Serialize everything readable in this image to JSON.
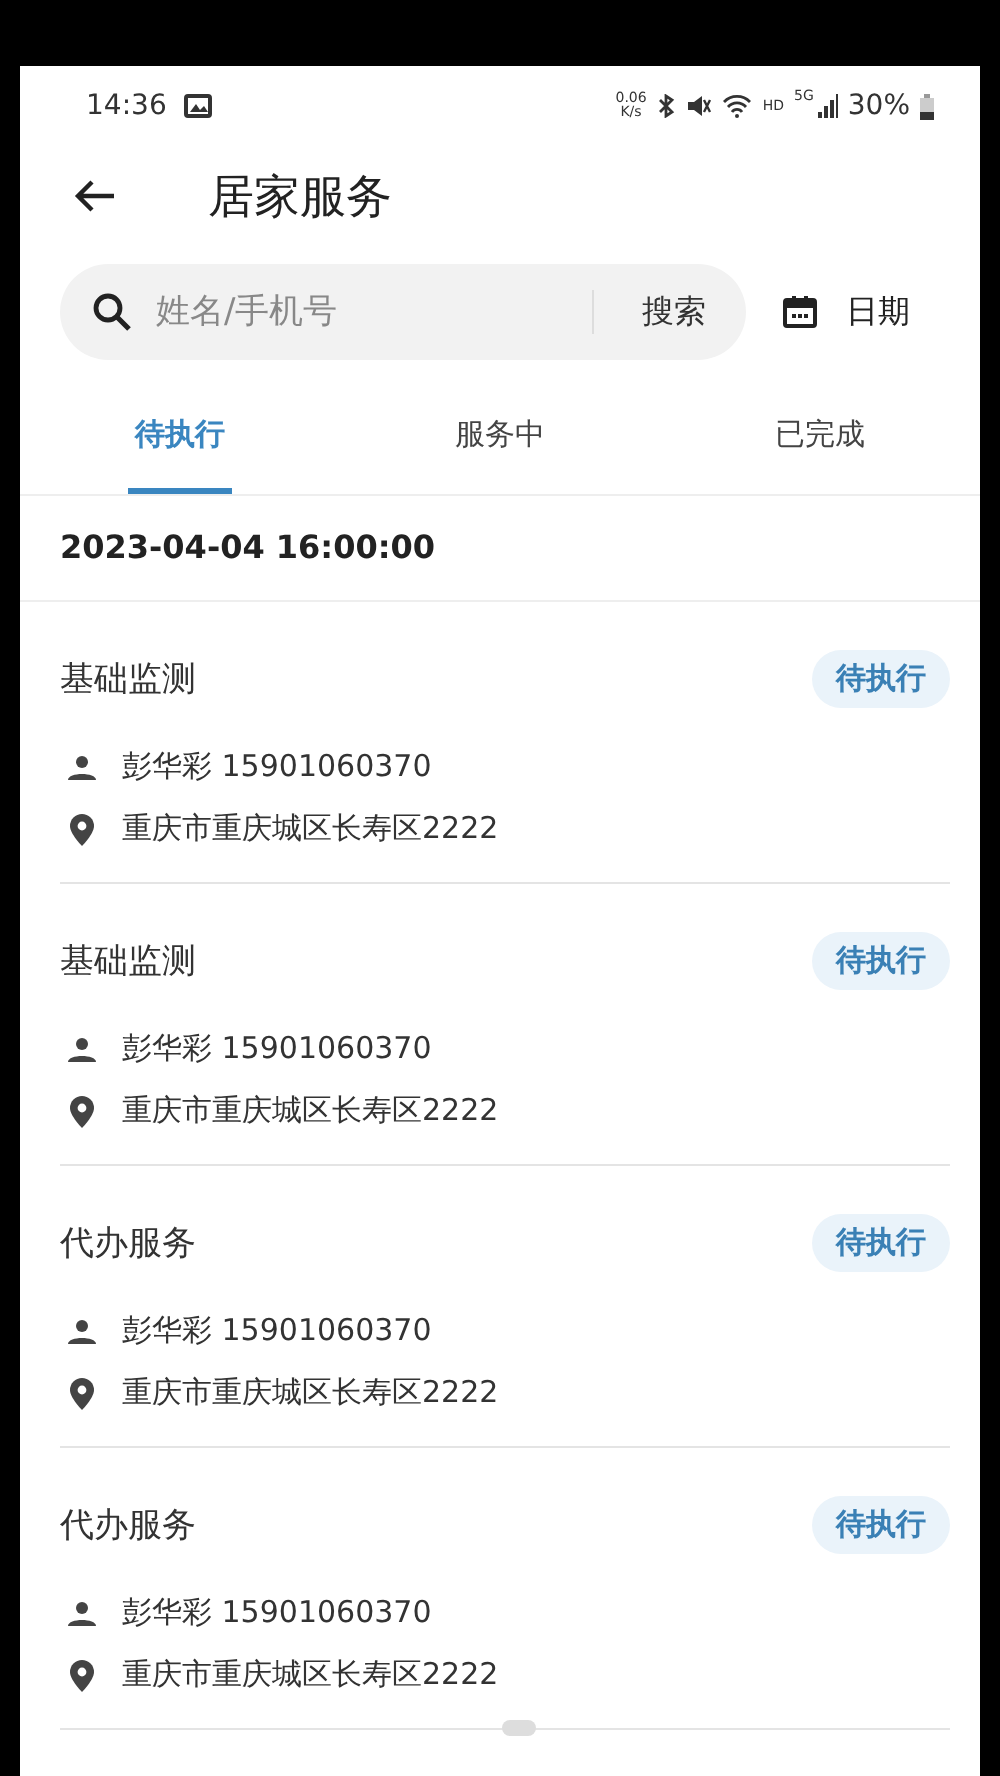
{
  "status_bar": {
    "time": "14:36",
    "net_speed": "0.06",
    "net_unit": "K/s",
    "hd": "HD",
    "network": "5G",
    "battery": "30%"
  },
  "header": {
    "title": "居家服务"
  },
  "search": {
    "placeholder": "姓名/手机号",
    "button": "搜索",
    "date_button": "日期"
  },
  "tabs": [
    {
      "label": "待执行",
      "selected": true
    },
    {
      "label": "服务中",
      "selected": false
    },
    {
      "label": "已完成",
      "selected": false
    }
  ],
  "date_heading": "2023-04-04 16:00:00",
  "orders": [
    {
      "title": "基础监测",
      "status": "待执行",
      "person": "彭华彩 15901060370",
      "address": "重庆市重庆城区长寿区2222"
    },
    {
      "title": "基础监测",
      "status": "待执行",
      "person": "彭华彩 15901060370",
      "address": "重庆市重庆城区长寿区2222"
    },
    {
      "title": "代办服务",
      "status": "待执行",
      "person": "彭华彩 15901060370",
      "address": "重庆市重庆城区长寿区2222"
    },
    {
      "title": "代办服务",
      "status": "待执行",
      "person": "彭华彩 15901060370",
      "address": "重庆市重庆城区长寿区2222"
    }
  ]
}
